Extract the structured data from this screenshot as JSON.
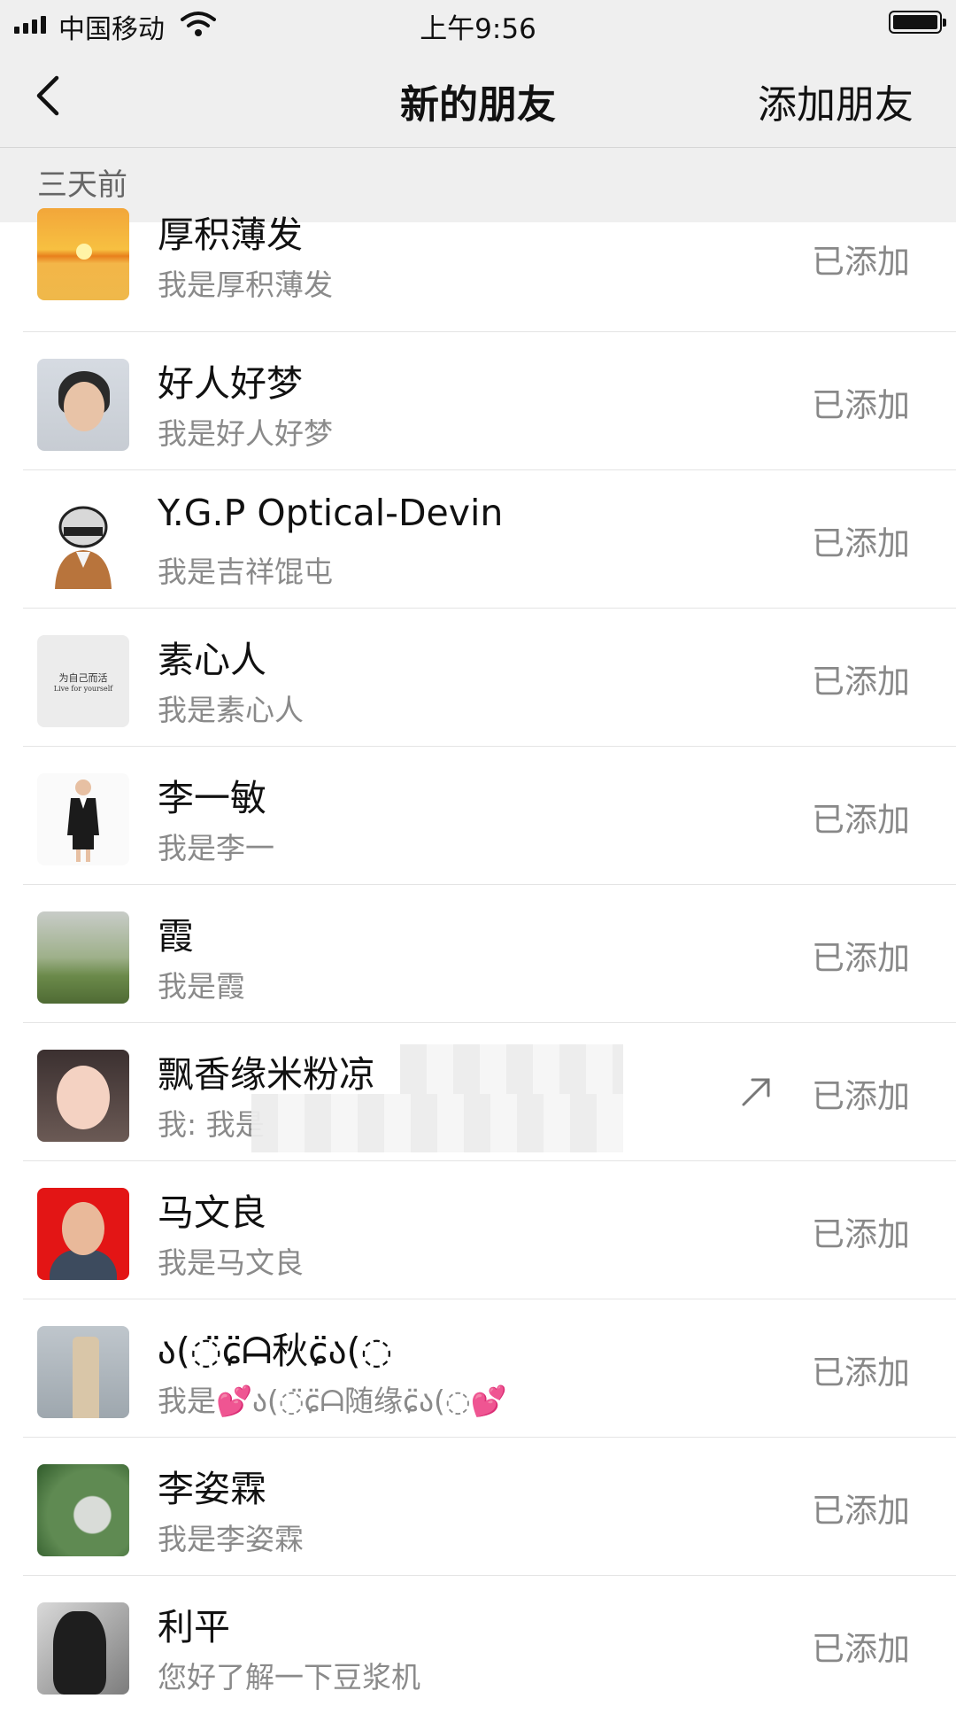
{
  "status_bar": {
    "carrier": "中国移动",
    "time": "上午9:56"
  },
  "nav": {
    "title": "新的朋友",
    "right_action": "添加朋友"
  },
  "section": {
    "label": "三天前"
  },
  "friends": [
    {
      "name": "厚积薄发",
      "message": "我是厚积薄发",
      "status": "已添加",
      "avatar": "sunset-avatar"
    },
    {
      "name": "好人好梦",
      "message": "我是好人好梦",
      "status": "已添加",
      "avatar": "girl-avatar"
    },
    {
      "name": "Y.G.P Optical-Devin",
      "message": "我是吉祥馄屯",
      "status": "已添加",
      "avatar": "cartoon-avatar"
    },
    {
      "name": "素心人",
      "message": "我是素心人",
      "status": "已添加",
      "avatar": "text-avatar",
      "avatar_text_1": "为自己而活",
      "avatar_text_2": "Live for yourself"
    },
    {
      "name": "李一敏",
      "message": "我是李一",
      "status": "已添加",
      "avatar": "businesswoman-avatar"
    },
    {
      "name": "霞",
      "message": "我是霞",
      "status": "已添加",
      "avatar": "field-avatar"
    },
    {
      "name": "飘香缘米粉凉",
      "message": "我: 我是",
      "status": "已添加",
      "avatar": "selfie-avatar",
      "has_share_icon": true
    },
    {
      "name": "马文良",
      "message": "我是马文良",
      "status": "已添加",
      "avatar": "portrait-red-avatar"
    },
    {
      "name": "ა(◌̈ɕ̈ᗩ秋ɕ̈ა(◌",
      "message": "我是💕ა(◌̈ɕ̈ᗩ随缘ɕ̈ა(◌💕",
      "status": "已添加",
      "avatar": "building-avatar"
    },
    {
      "name": "李姿霖",
      "message": "我是李姿霖",
      "status": "已添加",
      "avatar": "plant-avatar"
    },
    {
      "name": "利平",
      "message": "您好了解一下豆浆机",
      "status": "已添加",
      "avatar": "bw-portrait-avatar"
    }
  ]
}
